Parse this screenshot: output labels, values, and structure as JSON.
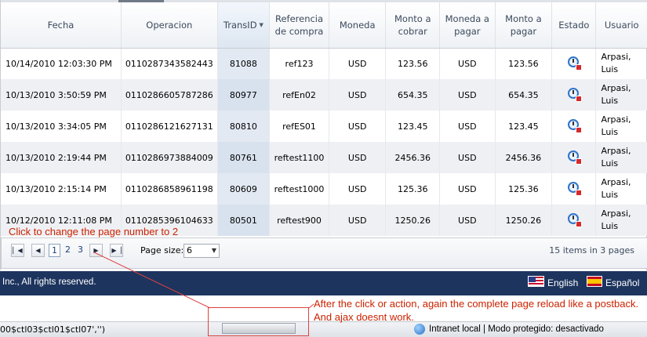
{
  "grid": {
    "columns": [
      {
        "label": "Fecha"
      },
      {
        "label": "Operacion"
      },
      {
        "label": "TransID",
        "sorted": true
      },
      {
        "label": "Referencia de compra"
      },
      {
        "label": "Moneda"
      },
      {
        "label": "Monto a cobrar"
      },
      {
        "label": "Moneda a pagar"
      },
      {
        "label": "Monto a pagar"
      },
      {
        "label": "Estado"
      },
      {
        "label": "Usuario"
      }
    ],
    "rows": [
      {
        "fecha": "10/14/2010 12:03:30 PM",
        "operacion": "0110287343582443",
        "transid": "81088",
        "referencia": "ref123",
        "moneda": "USD",
        "monto_cobrar": "123.56",
        "moneda_pagar": "USD",
        "monto_pagar": "123.56",
        "estado_icon": "status-clock-error-icon",
        "usuario": "Arpasi, Luis"
      },
      {
        "fecha": "10/13/2010 3:50:59 PM",
        "operacion": "0110286605787286",
        "transid": "80977",
        "referencia": "refEn02",
        "moneda": "USD",
        "monto_cobrar": "654.35",
        "moneda_pagar": "USD",
        "monto_pagar": "654.35",
        "estado_icon": "status-clock-error-icon",
        "usuario": "Arpasi, Luis"
      },
      {
        "fecha": "10/13/2010 3:34:05 PM",
        "operacion": "0110286121627131",
        "transid": "80810",
        "referencia": "refES01",
        "moneda": "USD",
        "monto_cobrar": "123.45",
        "moneda_pagar": "USD",
        "monto_pagar": "123.45",
        "estado_icon": "status-clock-error-icon",
        "usuario": "Arpasi, Luis"
      },
      {
        "fecha": "10/13/2010 2:19:44 PM",
        "operacion": "0110286973884009",
        "transid": "80761",
        "referencia": "reftest1100",
        "moneda": "USD",
        "monto_cobrar": "2456.36",
        "moneda_pagar": "USD",
        "monto_pagar": "2456.36",
        "estado_icon": "status-clock-error-icon",
        "usuario": "Arpasi, Luis"
      },
      {
        "fecha": "10/13/2010 2:15:14 PM",
        "operacion": "0110286858961198",
        "transid": "80609",
        "referencia": "reftest1000",
        "moneda": "USD",
        "monto_cobrar": "125.36",
        "moneda_pagar": "USD",
        "monto_pagar": "125.36",
        "estado_icon": "status-clock-error-icon",
        "usuario": "Arpasi, Luis"
      },
      {
        "fecha": "10/12/2010 12:11:08 PM",
        "operacion": "0110285396104633",
        "transid": "80501",
        "referencia": "reftest900",
        "moneda": "USD",
        "monto_cobrar": "1250.26",
        "moneda_pagar": "USD",
        "monto_pagar": "1250.26",
        "estado_icon": "status-clock-error-icon",
        "usuario": "Arpasi, Luis"
      }
    ]
  },
  "pager": {
    "first_icon": "first-page-icon",
    "prev_icon": "previous-page-icon",
    "next_icon": "next-page-icon",
    "last_icon": "last-page-icon",
    "pages": [
      "1",
      "2",
      "3"
    ],
    "current_page": "1",
    "page_size_label": "Page size:",
    "page_size_value": "6",
    "info": "15 items in 3 pages"
  },
  "annotations": {
    "click_note": "Click to change the page number to 2",
    "reload_note": "After the click or action, again the complete page reload like a postback. And ajax doesnt work."
  },
  "footer": {
    "copyright": "Inc., All rights reserved.",
    "lang_en": "English",
    "lang_es": "Español"
  },
  "statusbar": {
    "left_text": "00$ctl03$ctl01$ctl07','')",
    "zone_text": "Intranet local | Modo protegido: desactivado"
  },
  "colors": {
    "footer_bg": "#1d355e",
    "annotation": "#cc2200",
    "sorted_column": "#e2e9f3"
  }
}
